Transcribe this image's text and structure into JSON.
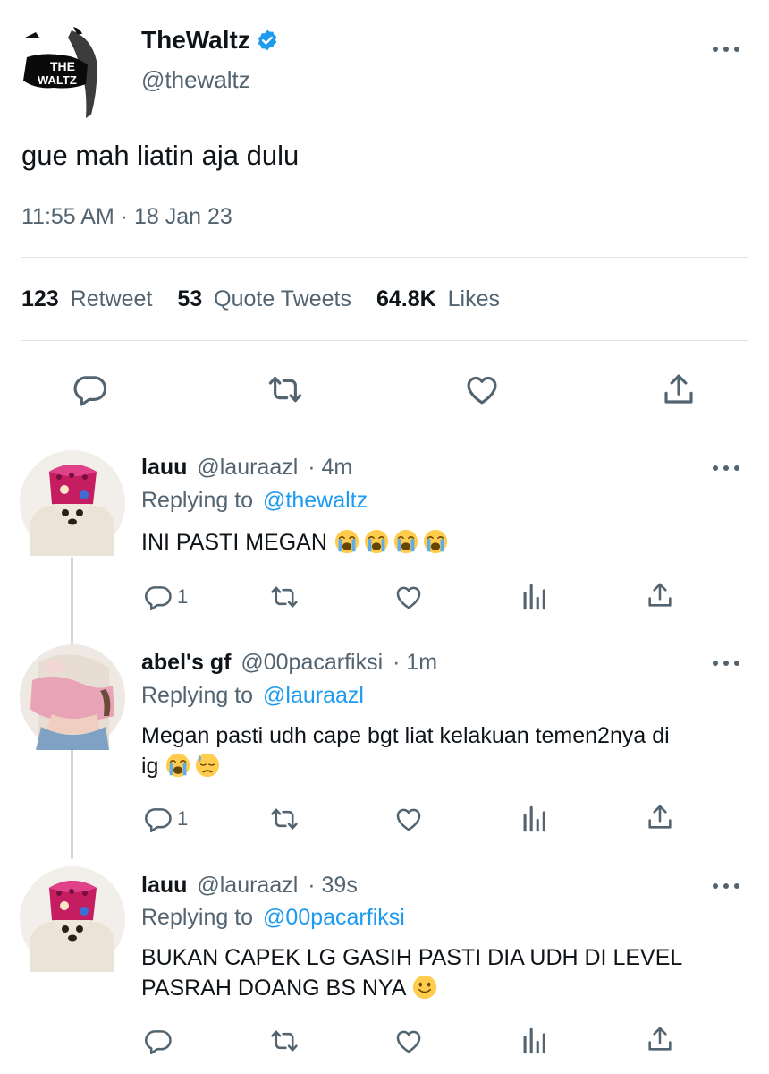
{
  "main_tweet": {
    "author_name": "TheWaltz",
    "author_handle": "@thewaltz",
    "logo_text": [
      "THE",
      "WALTZ"
    ],
    "verified": true,
    "text": "gue mah liatin aja dulu",
    "timestamp": "11:55 AM · 18 Jan 23",
    "stats": {
      "retweets_count": "123",
      "retweets_label": "Retweet",
      "quotes_count": "53",
      "quotes_label": "Quote Tweets",
      "likes_count": "64.8K",
      "likes_label": "Likes"
    }
  },
  "replies": [
    {
      "author_name": "lauu",
      "author_handle": "@lauraazl",
      "time": "· 4m",
      "replying_label": "Replying to",
      "replying_to": "@thewaltz",
      "text": "INI PASTI MEGAN",
      "emojis": [
        "loudly-crying-face",
        "loudly-crying-face",
        "loudly-crying-face",
        "loudly-crying-face"
      ],
      "reply_count": "1"
    },
    {
      "author_name": "abel's gf",
      "author_handle": "@00pacarfiksi",
      "time": "· 1m",
      "replying_label": "Replying to",
      "replying_to": "@lauraazl",
      "text_line1": "Megan pasti udh cape bgt liat kelakuan temen2nya di",
      "text_line2": "ig",
      "emojis": [
        "loudly-crying-face",
        "downcast-face-with-sweat"
      ],
      "reply_count": "1"
    },
    {
      "author_name": "lauu",
      "author_handle": "@lauraazl",
      "time": "· 39s",
      "replying_label": "Replying to",
      "replying_to": "@00pacarfiksi",
      "text_line1": "BUKAN CAPEK LG GASIH PASTI DIA UDH DI LEVEL",
      "text_line2": "PASRAH DOANG BS NYA",
      "emojis": [
        "slightly-smiling-face"
      ],
      "reply_count": ""
    }
  ],
  "colors": {
    "text": "#0f1419",
    "secondary": "#536471",
    "link": "#1d9bf0",
    "divider": "#dfe3e6",
    "thread_line": "#cfd9de"
  }
}
